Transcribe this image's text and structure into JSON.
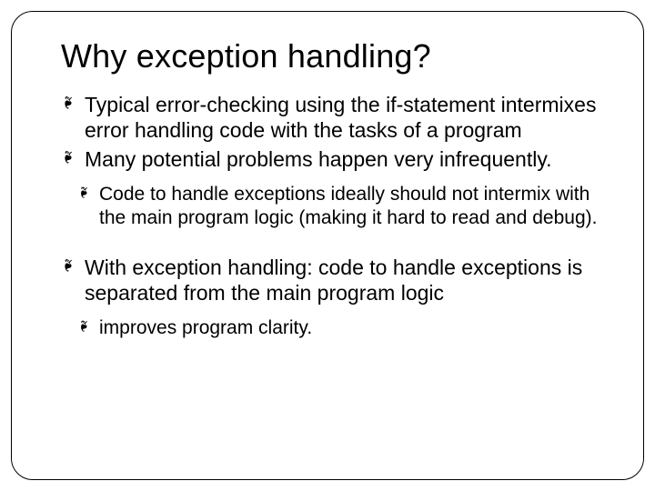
{
  "slide": {
    "title": "Why exception handling?",
    "bullets": [
      "Typical error-checking using the if-statement intermixes error handling code with the tasks of a program",
      "Many potential problems happen very infrequently."
    ],
    "subBullets": [
      "Code to handle exceptions ideally should not intermix with the main program logic (making it hard to read and debug)."
    ],
    "bullets2": [
      "With exception handling: code to handle exceptions is separated from the main program logic"
    ],
    "subBullets2": [
      "improves program clarity."
    ]
  }
}
